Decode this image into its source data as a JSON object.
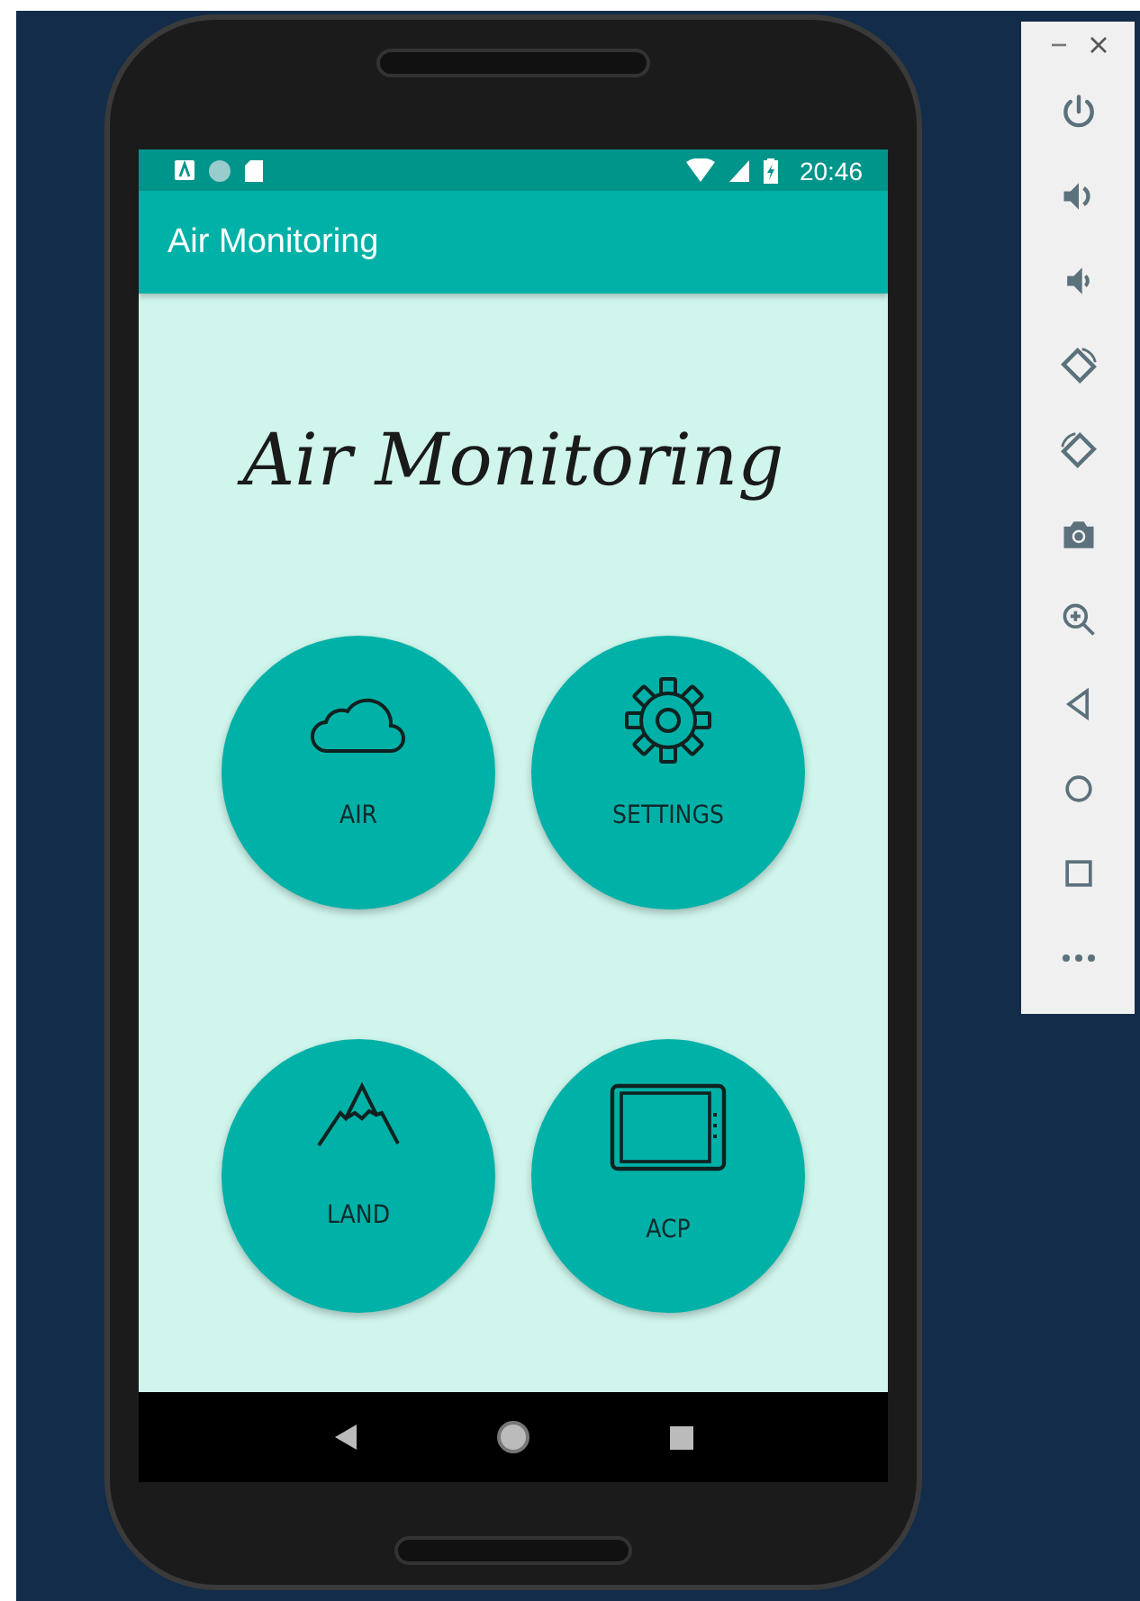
{
  "emulator_toolbar": {
    "tools": [
      {
        "kind": "power"
      },
      {
        "kind": "volume-up"
      },
      {
        "kind": "volume-down"
      },
      {
        "kind": "rotate-left"
      },
      {
        "kind": "rotate-right"
      },
      {
        "kind": "camera"
      },
      {
        "kind": "zoom"
      },
      {
        "kind": "back"
      },
      {
        "kind": "home"
      },
      {
        "kind": "overview"
      },
      {
        "kind": "more"
      }
    ]
  },
  "status_bar": {
    "time": "20:46"
  },
  "app_bar": {
    "title": "Air Monitoring"
  },
  "heading": "Air Monitoring",
  "tiles": [
    {
      "label": "AIR",
      "kind": "cloud"
    },
    {
      "label": "SETTINGS",
      "kind": "gear"
    },
    {
      "label": "LAND",
      "kind": "mountain"
    },
    {
      "label": "ACP",
      "kind": "tablet"
    }
  ]
}
